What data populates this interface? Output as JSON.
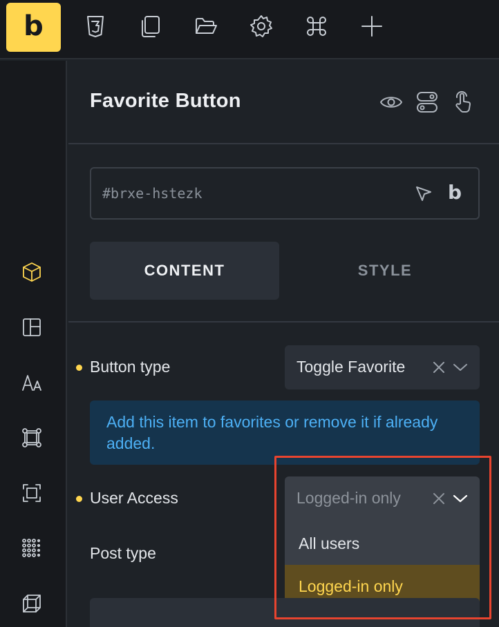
{
  "toolbar": {
    "logo_letter": "b",
    "items": [
      {
        "name": "css3-icon"
      },
      {
        "name": "pages-icon"
      },
      {
        "name": "folder-icon"
      },
      {
        "name": "settings-gear-icon"
      },
      {
        "name": "command-icon"
      },
      {
        "name": "add-plus-icon"
      }
    ]
  },
  "rail": {
    "items": [
      {
        "name": "element-box-icon",
        "active": true
      },
      {
        "name": "layout-icon",
        "active": false
      },
      {
        "name": "typography-icon",
        "active": false
      },
      {
        "name": "component-icon",
        "active": false
      },
      {
        "name": "frame-icon",
        "active": false
      },
      {
        "name": "grid-dots-icon",
        "active": false
      },
      {
        "name": "cube-icon",
        "active": false
      }
    ]
  },
  "panel": {
    "title": "Favorite Button",
    "element_id_placeholder": "#brxe-hstezk",
    "id_badge": "b",
    "tabs": {
      "content": "CONTENT",
      "style": "STYLE"
    },
    "fields": {
      "button_type": {
        "label": "Button type",
        "value": "Toggle Favorite"
      },
      "info_text": "Add this item to favorites or remove it if already added.",
      "user_access": {
        "label": "User Access",
        "value": "Logged-in only",
        "options": [
          "All users",
          "Logged-in only"
        ],
        "selected": "Logged-in only"
      },
      "post_type": {
        "label": "Post type"
      }
    }
  },
  "colors": {
    "accent": "#ffd64f",
    "info_text": "#4db0f5",
    "info_bg": "#15344d",
    "highlight": "#e8442f",
    "selected_option_bg": "#5f4d1f"
  }
}
